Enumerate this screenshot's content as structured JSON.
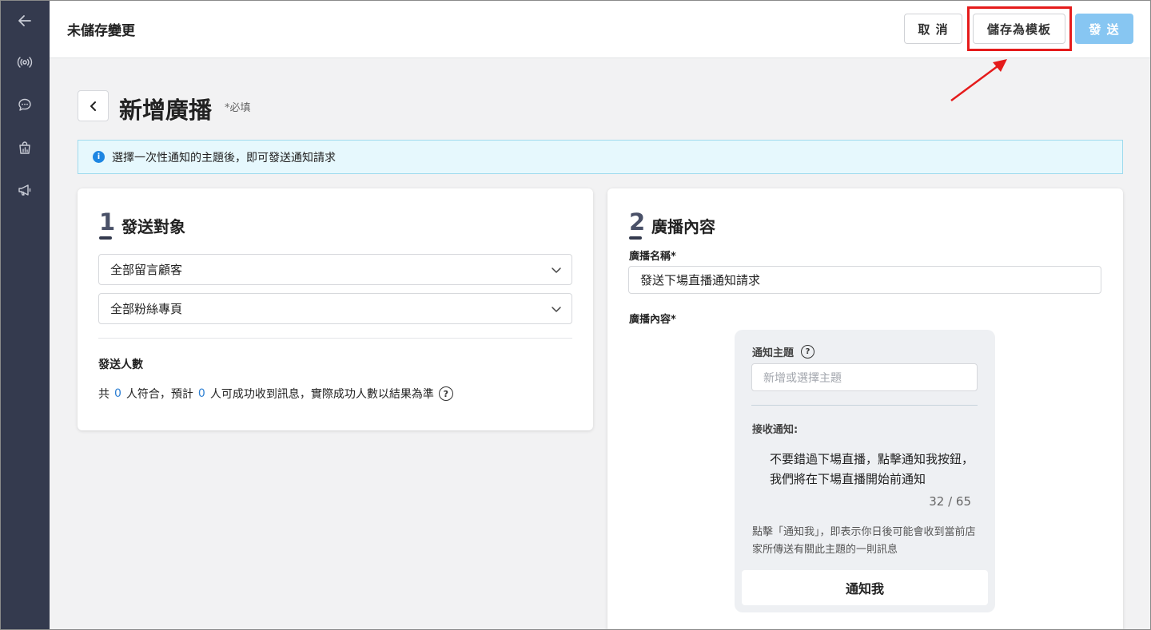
{
  "topbar": {
    "title": "未儲存變更",
    "cancel_label": "取 消",
    "save_template_label": "儲存為模板",
    "send_label": "發 送"
  },
  "page": {
    "title": "新增廣播",
    "required_note": "*必填"
  },
  "info": {
    "icon": "info-icon",
    "text": "選擇一次性通知的主題後，即可發送通知請求"
  },
  "section1": {
    "number": "1",
    "title": "發送對象",
    "select_audience": "全部留言顧客",
    "select_page": "全部粉絲專頁",
    "count_title": "發送人數",
    "count_prefix": "共",
    "count_matched": "0",
    "count_mid": "人符合，預計",
    "count_expected": "0",
    "count_suffix": "人可成功收到訊息，實際成功人數以結果為準"
  },
  "section2": {
    "number": "2",
    "title": "廣播內容",
    "name_label": "廣播名稱*",
    "name_value": "發送下場直播通知請求",
    "content_label": "廣播內容*",
    "preview": {
      "topic_label": "通知主題",
      "topic_placeholder": "新增或選擇主題",
      "receive_label": "接收通知:",
      "message": "不要錯過下場直播，點擊通知我按鈕，我們將在下場直播開始前通知",
      "counter": "32 / 65",
      "note": "點擊「通知我」，即表示你日後可能會收到當前店家所傳送有關此主題的一則訊息",
      "button_label": "通知我"
    }
  },
  "colors": {
    "sidebar": "#343a4e",
    "send_button": "#87c6f2",
    "highlight": "#e51b1b",
    "info_bg": "#e6f8fd",
    "link_number": "#2d7fd3"
  }
}
